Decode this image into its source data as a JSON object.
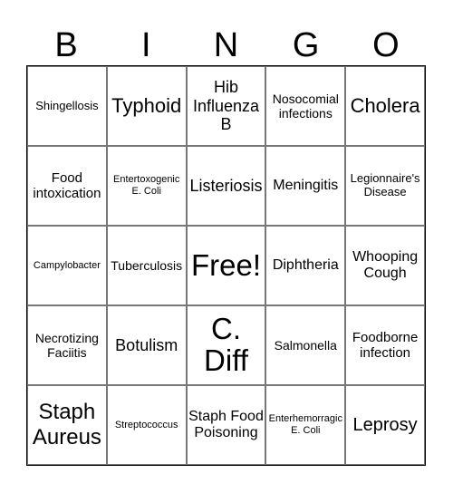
{
  "header": {
    "letters": [
      "B",
      "I",
      "N",
      "G",
      "O"
    ]
  },
  "cells": [
    [
      "Shingellosis",
      "Typhoid",
      "Hib Influenza B",
      "Nosocomial infections",
      "Cholera"
    ],
    [
      "Food intoxication",
      "Entertoxogenic E. Coli",
      "Listeriosis",
      "Meningitis",
      "Legionnaire's Disease"
    ],
    [
      "Campylobacter",
      "Tuberculosis",
      "Free!",
      "Diphtheria",
      "Whooping Cough"
    ],
    [
      "Necrotizing Faciitis",
      "Botulism",
      "C. Diff",
      "Salmonella",
      "Foodborne infection"
    ],
    [
      "Staph Aureus",
      "Streptococcus",
      "Staph Food Poisoning",
      "Enterhemorragic E. Coli",
      "Leprosy"
    ]
  ]
}
